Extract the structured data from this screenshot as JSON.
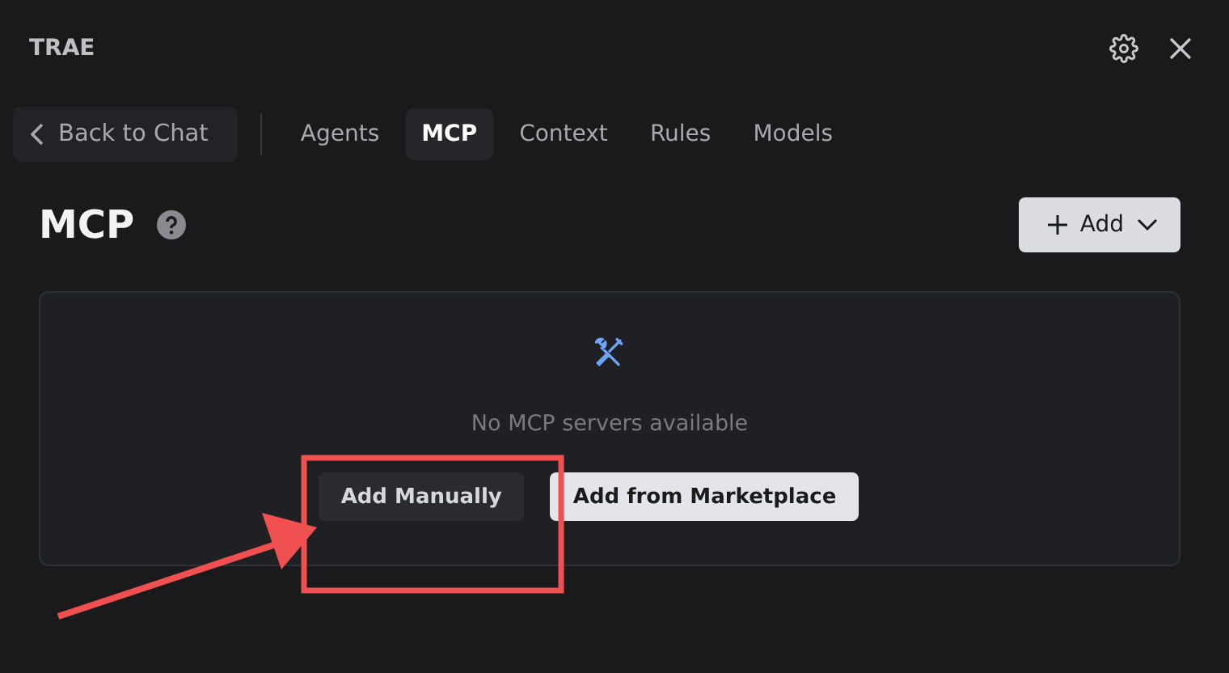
{
  "window": {
    "title": "TRAE"
  },
  "back_button": {
    "label": "Back to Chat"
  },
  "tabs": [
    {
      "label": "Agents",
      "selected": false
    },
    {
      "label": "MCP",
      "selected": true
    },
    {
      "label": "Context",
      "selected": false
    },
    {
      "label": "Rules",
      "selected": false
    },
    {
      "label": "Models",
      "selected": false
    }
  ],
  "heading": "MCP",
  "add_button": {
    "label": "Add"
  },
  "empty_state": {
    "message": "No MCP servers available",
    "buttons": [
      {
        "label": "Add Manually",
        "kind": "secondary"
      },
      {
        "label": "Add from Marketplace",
        "kind": "primary"
      }
    ]
  },
  "annotation": {
    "highlight_box": true,
    "arrow": true
  }
}
